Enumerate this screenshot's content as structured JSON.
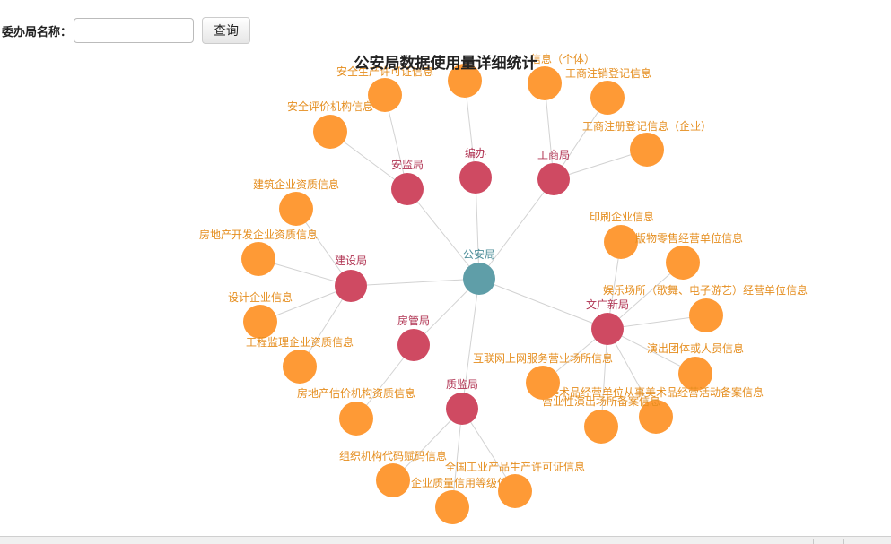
{
  "search": {
    "label": "委办局名称：",
    "value": "",
    "placeholder": "",
    "button_label": "查询"
  },
  "colors": {
    "center": "#5f9ea8",
    "department": "#cf4a62",
    "dataset": "#fe9a36",
    "center_label": "#4f8f9a",
    "department_label": "#b03352",
    "dataset_label": "#e58e1f",
    "edge": "#d2d2d2"
  },
  "chart_data": {
    "type": "network",
    "title": "公安局数据使用量详细统计",
    "center": {
      "id": "center",
      "label": "公安局"
    },
    "nodes": [
      {
        "id": "anjian",
        "label": "安监局",
        "group": "department",
        "parent": "center"
      },
      {
        "id": "bianban",
        "label": "编办",
        "group": "department",
        "parent": "center"
      },
      {
        "id": "gongshang",
        "label": "工商局",
        "group": "department",
        "parent": "center"
      },
      {
        "id": "jianshe",
        "label": "建设局",
        "group": "department",
        "parent": "center"
      },
      {
        "id": "fangguan",
        "label": "房管局",
        "group": "department",
        "parent": "center"
      },
      {
        "id": "zhijian",
        "label": "质监局",
        "group": "department",
        "parent": "center"
      },
      {
        "id": "wenguang",
        "label": "文广新局",
        "group": "department",
        "parent": "center"
      },
      {
        "id": "aj1",
        "label": "安全生产许可证信息",
        "group": "dataset",
        "parent": "anjian"
      },
      {
        "id": "aj2",
        "label": "安全评价机构信息",
        "group": "dataset",
        "parent": "anjian"
      },
      {
        "id": "bb1",
        "label": "",
        "group": "dataset",
        "parent": "bianban"
      },
      {
        "id": "gs1",
        "label": "信息（个体）",
        "group": "dataset",
        "parent": "gongshang"
      },
      {
        "id": "gs2",
        "label": "工商注销登记信息",
        "group": "dataset",
        "parent": "gongshang"
      },
      {
        "id": "gs3",
        "label": "工商注册登记信息（企业）",
        "group": "dataset",
        "parent": "gongshang"
      },
      {
        "id": "js1",
        "label": "建筑企业资质信息",
        "group": "dataset",
        "parent": "jianshe"
      },
      {
        "id": "js2",
        "label": "房地产开发企业资质信息",
        "group": "dataset",
        "parent": "jianshe"
      },
      {
        "id": "js3",
        "label": "设计企业信息",
        "group": "dataset",
        "parent": "jianshe"
      },
      {
        "id": "js4",
        "label": "工程监理企业资质信息",
        "group": "dataset",
        "parent": "jianshe"
      },
      {
        "id": "fg1",
        "label": "房地产估价机构资质信息",
        "group": "dataset",
        "parent": "fangguan"
      },
      {
        "id": "zj1",
        "label": "组织机构代码赋码信息",
        "group": "dataset",
        "parent": "zhijian"
      },
      {
        "id": "zj2",
        "label": "企业质量信用等级信",
        "group": "dataset",
        "parent": "zhijian"
      },
      {
        "id": "zj3",
        "label": "全国工业产品生产许可证信息",
        "group": "dataset",
        "parent": "zhijian"
      },
      {
        "id": "wg1",
        "label": "印刷企业信息",
        "group": "dataset",
        "parent": "wenguang"
      },
      {
        "id": "wg2",
        "label": "版物零售经营单位信息",
        "group": "dataset",
        "parent": "wenguang"
      },
      {
        "id": "wg3",
        "label": "娱乐场所（歌舞、电子游艺）经营单位信息",
        "group": "dataset",
        "parent": "wenguang"
      },
      {
        "id": "wg4",
        "label": "演出团体或人员信息",
        "group": "dataset",
        "parent": "wenguang"
      },
      {
        "id": "wg5",
        "label": "美术品经营单位从事美术品经营活动备案信息",
        "group": "dataset",
        "parent": "wenguang"
      },
      {
        "id": "wg6",
        "label": "营业性演出场所备案信息",
        "group": "dataset",
        "parent": "wenguang"
      },
      {
        "id": "wg7",
        "label": "互联网上网服务营业场所信息",
        "group": "dataset",
        "parent": "wenguang"
      }
    ]
  }
}
